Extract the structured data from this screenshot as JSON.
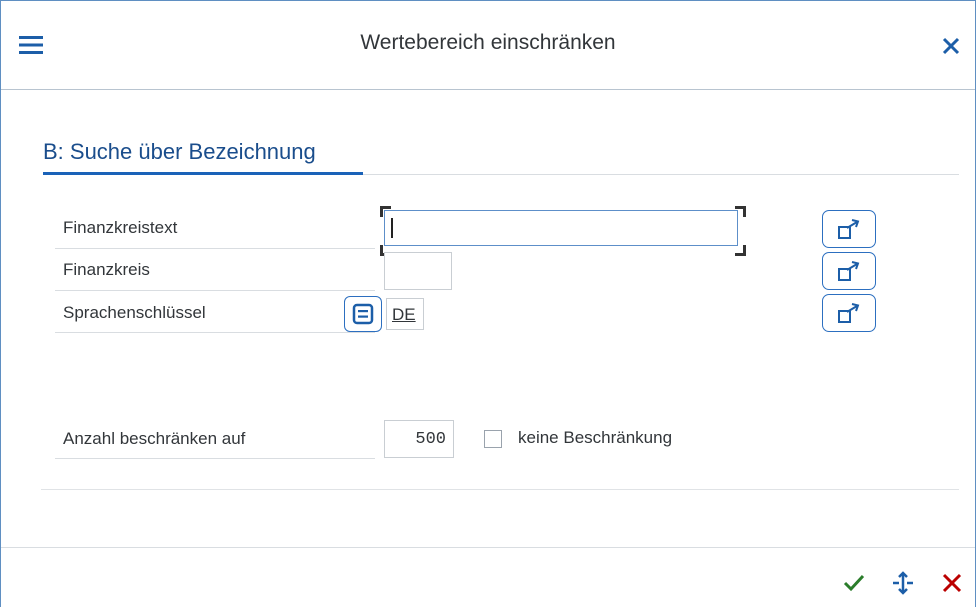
{
  "header": {
    "title": "Wertebereich einschränken",
    "menu_icon": "hamburger-menu-icon",
    "close_icon": "close-icon"
  },
  "section": {
    "title": "B: Suche über Bezeichnung"
  },
  "fields": {
    "finanzkreistext": {
      "label": "Finanzkreistext",
      "value": ""
    },
    "finanzkreis": {
      "label": "Finanzkreis",
      "value": ""
    },
    "sprachenschluessel": {
      "label": "Sprachenschlüssel",
      "value": "DE"
    }
  },
  "limit": {
    "label": "Anzahl beschränken auf",
    "value": "500",
    "no_limit_label": "keine Beschränkung",
    "no_limit_checked": false
  },
  "footer": {
    "confirm_icon": "checkmark-icon",
    "navigate_icon": "transfer-icon",
    "cancel_icon": "cancel-icon"
  },
  "colors": {
    "accent": "#1a62b8",
    "confirm": "#2b7d2b",
    "cancel": "#bb0000"
  }
}
